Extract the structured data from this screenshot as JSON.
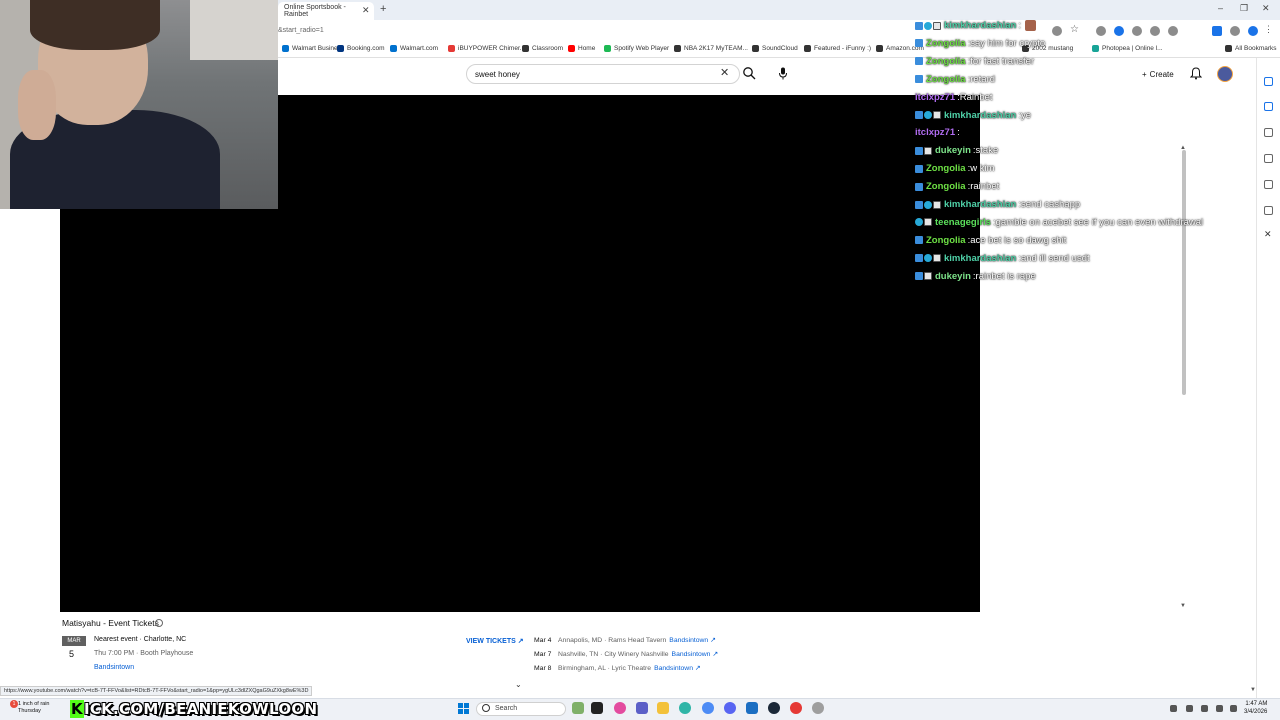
{
  "browser": {
    "active_tab_title": "Online Sportsbook - Rainbet",
    "url": "&start_radio=1",
    "bookmarks": [
      {
        "label": "Walmart Business",
        "color": "#0071ce"
      },
      {
        "label": "Booking.com",
        "color": "#003580"
      },
      {
        "label": "Walmart.com",
        "color": "#0071ce"
      },
      {
        "label": "iBUYPOWER Chimer...",
        "color": "#e53935"
      },
      {
        "label": "Classroom",
        "color": "#333333"
      },
      {
        "label": "Home",
        "color": "#ff0000"
      },
      {
        "label": "Spotify Web Player",
        "color": "#1db954"
      },
      {
        "label": "NBA 2K17 MyTEAM...",
        "color": "#333333"
      },
      {
        "label": "SoundCloud",
        "color": "#333333"
      },
      {
        "label": "Featured - iFunny :)",
        "color": "#333333"
      },
      {
        "label": "Amazon.com",
        "color": "#333333"
      },
      {
        "label": "2002 mustang",
        "color": "#333333"
      },
      {
        "label": "Photopea | Online l...",
        "color": "#18a497"
      },
      {
        "label": "All Bookmarks",
        "color": "#333333"
      }
    ]
  },
  "youtube": {
    "search_value": "sweet honey",
    "create_label": "Create"
  },
  "chat": [
    {
      "user": "kimkhardashian",
      "color": "#4fd1a8",
      "badges": [
        "blue",
        "cyan",
        "white"
      ],
      "msg": "",
      "avatar": true
    },
    {
      "user": "Zongolia",
      "color": "#6ee045",
      "badges": [
        "blue"
      ],
      "msg": "say him for crypto"
    },
    {
      "user": "Zongolia",
      "color": "#6ee045",
      "badges": [
        "blue"
      ],
      "msg": "for fast transfer"
    },
    {
      "user": "Zongolia",
      "color": "#6ee045",
      "badges": [
        "blue"
      ],
      "msg": "retard"
    },
    {
      "user": "itclxpz71",
      "color": "#b06cf0",
      "badges": [],
      "msg": "Rainbet"
    },
    {
      "user": "kimkhardashian",
      "color": "#4fd1a8",
      "badges": [
        "blue",
        "cyan",
        "white"
      ],
      "msg": "ye"
    },
    {
      "user": "itclxpz71",
      "color": "#b06cf0",
      "badges": [],
      "msg": ""
    },
    {
      "user": "dukeyin",
      "color": "#7de38a",
      "badges": [
        "blue",
        "white"
      ],
      "msg": "stake"
    },
    {
      "user": "Zongolia",
      "color": "#6ee045",
      "badges": [
        "blue"
      ],
      "msg": "w kim"
    },
    {
      "user": "Zongolia",
      "color": "#6ee045",
      "badges": [
        "blue"
      ],
      "msg": "rainbet"
    },
    {
      "user": "kimkhardashian",
      "color": "#4fd1a8",
      "badges": [
        "blue",
        "cyan",
        "white"
      ],
      "msg": "send cashapp"
    },
    {
      "user": "teenagegirls",
      "color": "#5be05b",
      "badges": [
        "cyan",
        "white"
      ],
      "msg": "gamble on acebet see if you can even withdrawal"
    },
    {
      "user": "Zongolia",
      "color": "#6ee045",
      "badges": [
        "blue"
      ],
      "msg": "ace bet is so dawg shit"
    },
    {
      "user": "kimkhardashian",
      "color": "#4fd1a8",
      "badges": [
        "blue",
        "cyan",
        "white"
      ],
      "msg": "and ill send usdt"
    },
    {
      "user": "dukeyin",
      "color": "#7de38a",
      "badges": [
        "blue",
        "white"
      ],
      "msg": "rainbet is rape"
    }
  ],
  "events": {
    "title": "Matisyahu - Event Tickets",
    "nearest_month": "MAR",
    "nearest_day": "5",
    "nearest_label": "Nearest event · Charlotte, NC",
    "nearest_time": "Thu 7:00 PM · Booth Playhouse",
    "nearest_source": "Bandsintown",
    "view_tickets": "VIEW TICKETS ↗",
    "list": [
      {
        "date": "Mar 4",
        "place": "Annapolis, MD · Rams Head Tavern",
        "source": "Bandsintown ↗"
      },
      {
        "date": "Mar 7",
        "place": "Nashville, TN · City Winery Nashville",
        "source": "Bandsintown ↗"
      },
      {
        "date": "Mar 8",
        "place": "Birmingham, AL · Lyric Theatre",
        "source": "Bandsintown ↗"
      }
    ]
  },
  "status_url": "https://www.youtube.com/watch?v=tcB-7T-FFVo&list=RDtcB-7T-FFVo&start_radio=1&pp=ygULc3dlZXQgaG9uZXkg8wE%3D",
  "taskbar": {
    "weather_line1": "1 inch of rain",
    "weather_line2": "Thursday",
    "banner": "KICK.COM/BEANIEKOWLOON",
    "banner_k": "K",
    "banner_rest": "ICK.COM/BEANIEKOWLOON",
    "search_placeholder": "Search",
    "time": "1:47 AM",
    "date": "3/4/2026"
  }
}
